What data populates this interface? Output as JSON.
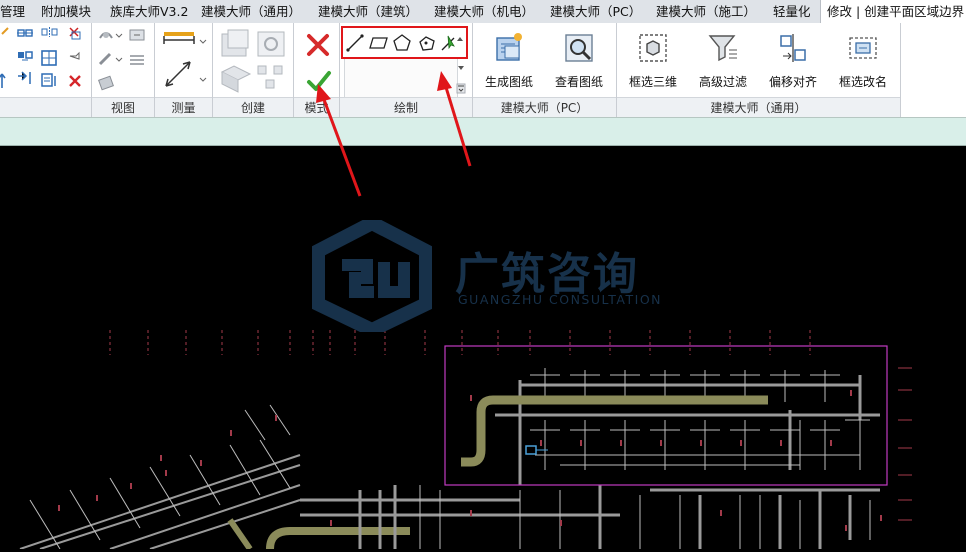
{
  "tabs": [
    {
      "label": "管理"
    },
    {
      "label": "附加模块"
    },
    {
      "label": "族库大师V3.2"
    },
    {
      "label": "建模大师（通用）"
    },
    {
      "label": "建模大师（建筑）"
    },
    {
      "label": "建模大师（机电）"
    },
    {
      "label": "建模大师（PC）"
    },
    {
      "label": "建模大师（施工）"
    },
    {
      "label": "轻量化"
    },
    {
      "label": "修改 | 创建平面区域边界"
    }
  ],
  "panels": {
    "view": "视图",
    "measure": "测量",
    "create": "创建",
    "mode": "模式",
    "draw": "绘制",
    "pc": "建模大师（PC）",
    "general": "建模大师（通用）"
  },
  "buttons": {
    "generate_drawing": "生成图纸",
    "view_drawing": "查看图纸",
    "box_3d": "框选三维",
    "advanced_filter": "高级过滤",
    "offset_align": "偏移对齐",
    "box_rename": "框选改名"
  },
  "watermark": {
    "logo_letters": "GU",
    "name_cn": "广筑咨询",
    "name_en": "GUANGZHU CONSULTATION"
  },
  "colors": {
    "highlight": "#e0161a",
    "selection_box": "#c23bc2",
    "options_bar": "#d9efe9",
    "watermark": "#17314a",
    "pipe_olive": "#8b8b5a"
  },
  "icons": [
    "cancel-icon",
    "finish-icon",
    "line-icon",
    "rectangle-icon",
    "polygon-icon",
    "circle-icon",
    "pick-lines-icon"
  ]
}
